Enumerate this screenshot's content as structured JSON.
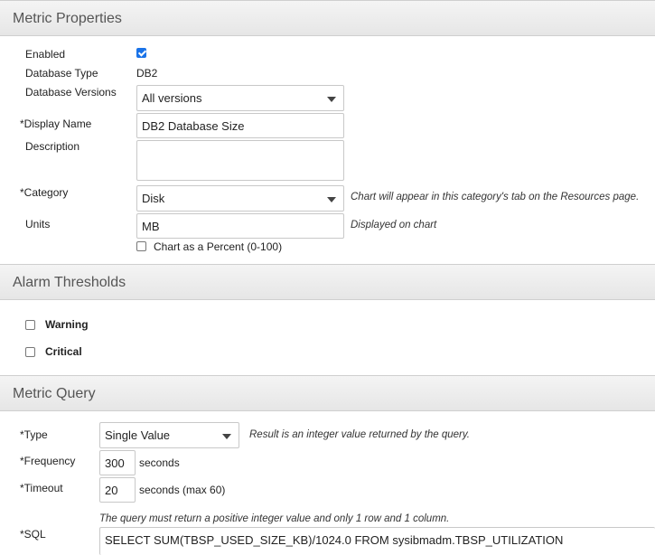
{
  "metric_properties": {
    "header": "Metric Properties",
    "enabled_label": "Enabled",
    "database_type_label": "Database Type",
    "database_type_value": "DB2",
    "database_versions_label": "Database Versions",
    "database_versions_value": "All versions",
    "display_name_label": "*Display Name",
    "display_name_value": "DB2 Database Size",
    "description_label": "Description",
    "description_value": "",
    "category_label": "*Category",
    "category_value": "Disk",
    "category_hint": "Chart will appear in this category's tab on the Resources page.",
    "units_label": "Units",
    "units_value": "MB",
    "units_hint": "Displayed on chart",
    "percent_label": "Chart as a Percent (0-100)"
  },
  "alarm_thresholds": {
    "header": "Alarm Thresholds",
    "warning_label": "Warning",
    "critical_label": "Critical"
  },
  "metric_query": {
    "header": "Metric Query",
    "type_label": "*Type",
    "type_value": "Single Value",
    "type_hint": "Result is an integer value returned by the query.",
    "frequency_label": "*Frequency",
    "frequency_value": "300",
    "frequency_unit": "seconds",
    "timeout_label": "*Timeout",
    "timeout_value": "20",
    "timeout_unit": "seconds (max 60)",
    "sql_hint": "The query must return a positive integer value and only 1 row and 1 column.",
    "sql_label": "*SQL",
    "sql_value": "SELECT SUM(TBSP_USED_SIZE_KB)/1024.0 FROM sysibmadm.TBSP_UTILIZATION"
  },
  "colors": {
    "checkbox_checked": "#1a73e8",
    "header_bg": "#e9e9e9"
  }
}
